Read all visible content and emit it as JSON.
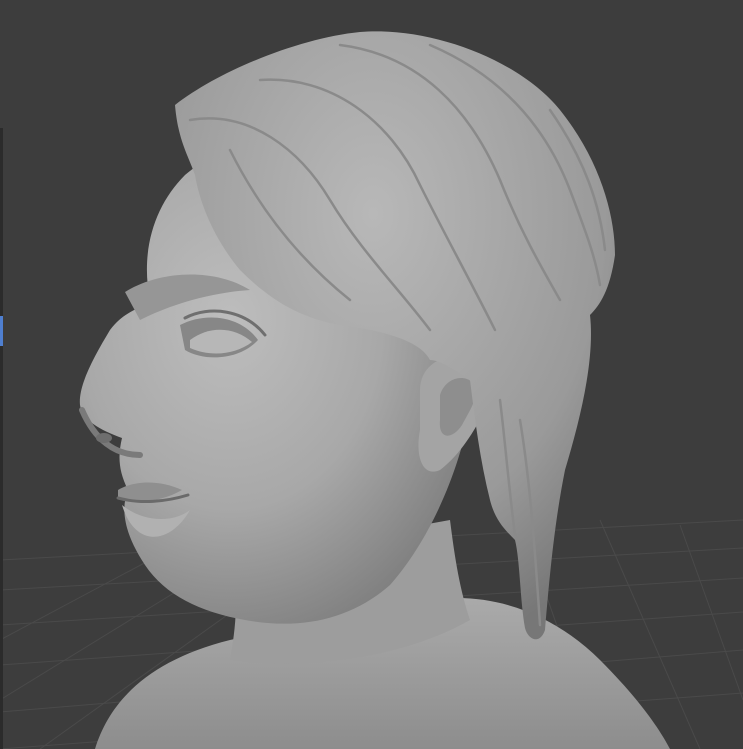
{
  "viewport": {
    "background": "#3d3d3d",
    "grid_color": "#4a4a4a",
    "sculpt_color": "#a9a9a9",
    "active_marker_color": "#4f7fd0"
  },
  "scene": {
    "object": "sculpted-head-bust",
    "grid_floor": true,
    "side_panel_edge": true
  }
}
